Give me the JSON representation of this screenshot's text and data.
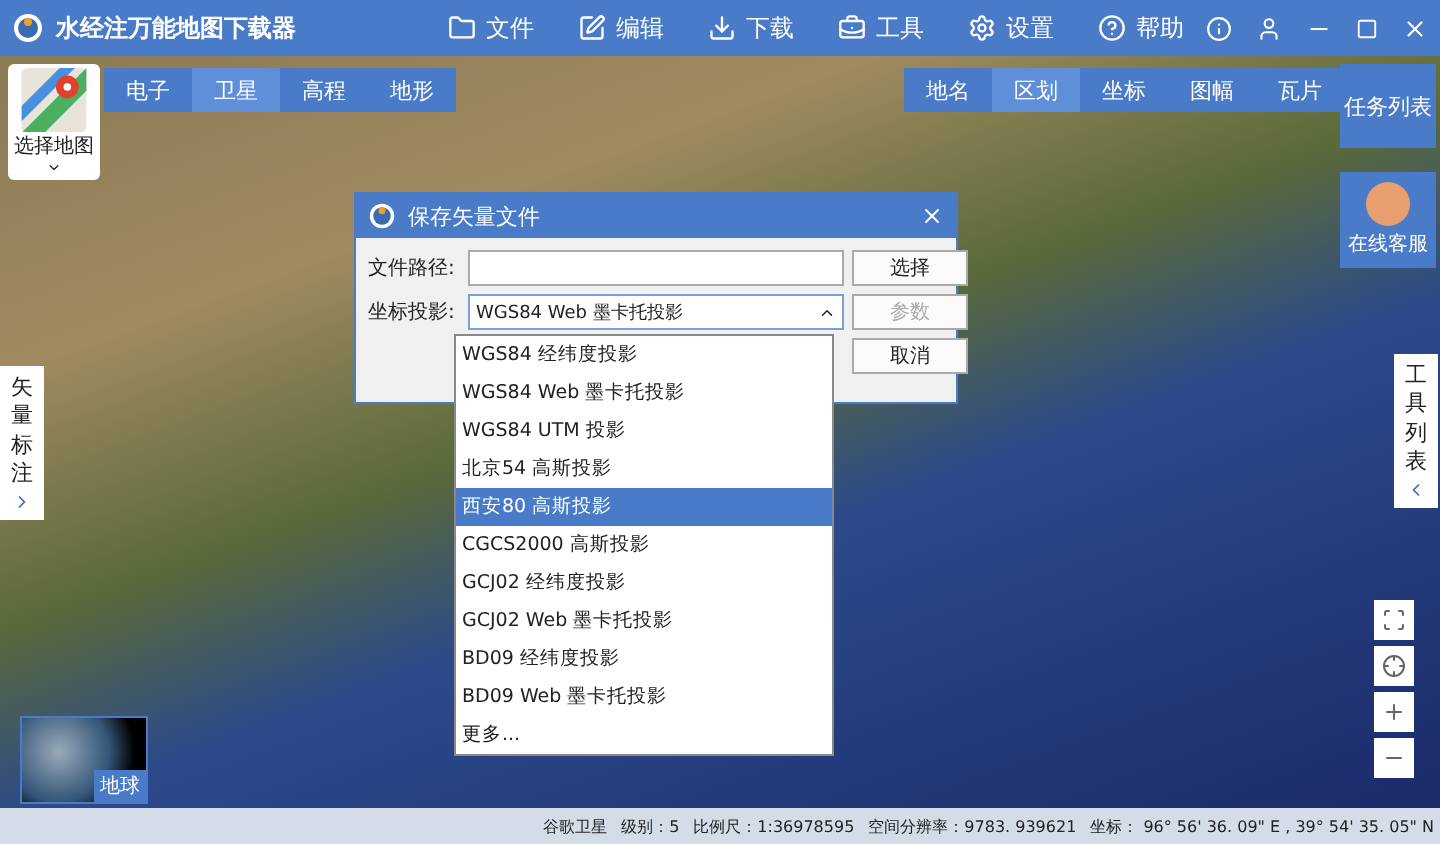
{
  "window": {
    "title": "水经注万能地图下载器"
  },
  "menu": [
    {
      "label": "文件"
    },
    {
      "label": "编辑"
    },
    {
      "label": "下载"
    },
    {
      "label": "工具"
    },
    {
      "label": "设置"
    },
    {
      "label": "帮助"
    }
  ],
  "map_chooser": {
    "label": "选择地图"
  },
  "map_types": [
    {
      "label": "电子",
      "selected": false
    },
    {
      "label": "卫星",
      "selected": true
    },
    {
      "label": "高程",
      "selected": false
    },
    {
      "label": "地形",
      "selected": false
    }
  ],
  "overlays": [
    {
      "label": "地名",
      "selected": false
    },
    {
      "label": "区划",
      "selected": true
    },
    {
      "label": "坐标",
      "selected": false
    },
    {
      "label": "图幅",
      "selected": false
    },
    {
      "label": "瓦片",
      "selected": false
    }
  ],
  "task_list": "任务列表",
  "support": "在线客服",
  "left_panel": "矢量标注",
  "right_panel": "工具列表",
  "globe": {
    "label": "地球"
  },
  "dialog": {
    "title": "保存矢量文件",
    "path_label": "文件路径:",
    "projection_label": "坐标投影:",
    "projection_value": "WGS84 Web 墨卡托投影",
    "buttons": [
      {
        "label": "选择",
        "disabled": false
      },
      {
        "label": "参数",
        "disabled": true
      },
      {
        "label": "取消",
        "disabled": false
      }
    ],
    "options": [
      {
        "label": "WGS84 经纬度投影",
        "selected": false
      },
      {
        "label": "WGS84 Web 墨卡托投影",
        "selected": false
      },
      {
        "label": "WGS84 UTM 投影",
        "selected": false
      },
      {
        "label": "北京54 高斯投影",
        "selected": false
      },
      {
        "label": "西安80 高斯投影",
        "selected": true
      },
      {
        "label": "CGCS2000 高斯投影",
        "selected": false
      },
      {
        "label": "GCJ02 经纬度投影",
        "selected": false
      },
      {
        "label": "GCJ02 Web 墨卡托投影",
        "selected": false
      },
      {
        "label": "BD09 经纬度投影",
        "selected": false
      },
      {
        "label": "BD09 Web 墨卡托投影",
        "selected": false
      },
      {
        "label": "更多...",
        "selected": false
      }
    ]
  },
  "status_bar": [
    "谷歌卫星",
    "级别：5",
    "比例尺：1:36978595",
    "空间分辨率：9783. 939621",
    "坐标：  96° 56' 36. 09\" E , 39° 54' 35. 05\" N"
  ]
}
